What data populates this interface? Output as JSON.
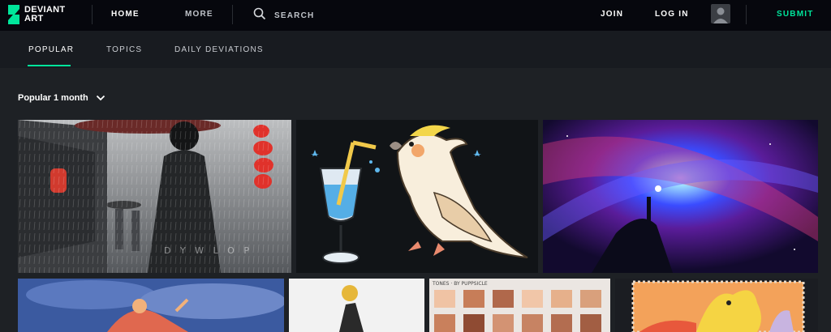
{
  "brand": {
    "line1": "DEVIANT",
    "line2": "ART",
    "color": "#00e59b"
  },
  "topnav": {
    "home": "HOME",
    "more": "MORE",
    "join": "JOIN",
    "login": "LOG IN",
    "submit": "SUBMIT"
  },
  "search": {
    "placeholder": "SEARCH",
    "icon": "search-icon"
  },
  "tabs": [
    {
      "label": "POPULAR",
      "active": true
    },
    {
      "label": "TOPICS"
    },
    {
      "label": "DAILY DEVIATIONS"
    }
  ],
  "filter": {
    "label": "Popular 1 month",
    "icon": "chevron-down-icon"
  },
  "thumbs": {
    "rain_watermark": "D Y W L O P",
    "tones_caption": "TONES · BY PUPPSICLE"
  },
  "colors": {
    "accent": "#00e59b",
    "topbar": "#06070d",
    "page": "#1e2125"
  }
}
